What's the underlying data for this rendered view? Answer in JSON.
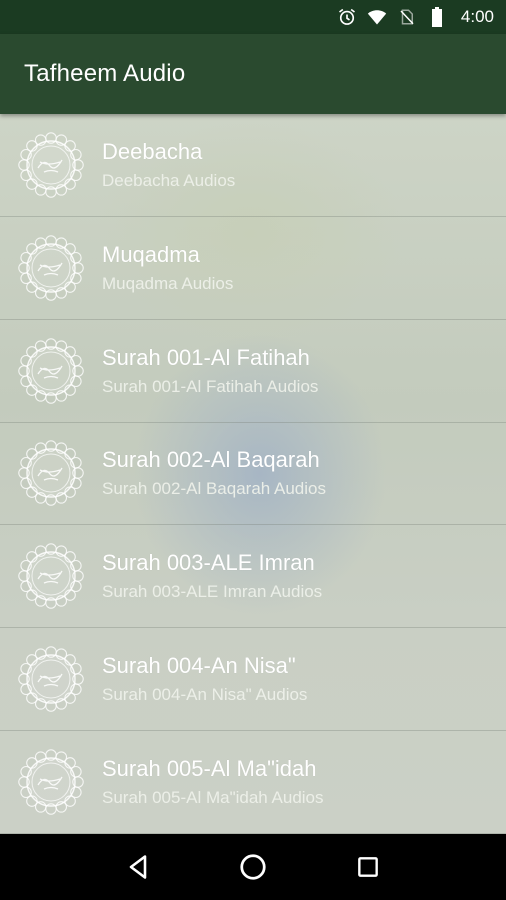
{
  "status_bar": {
    "time": "4:00",
    "icons": [
      "alarm-icon",
      "wifi-icon",
      "no-sim-icon",
      "battery-icon"
    ]
  },
  "app_bar": {
    "title": "Tafheem Audio"
  },
  "items": [
    {
      "title": "Deebacha",
      "subtitle": "Deebacha Audios"
    },
    {
      "title": "Muqadma",
      "subtitle": "Muqadma Audios"
    },
    {
      "title": "Surah 001-Al Fatihah",
      "subtitle": "Surah 001-Al Fatihah Audios"
    },
    {
      "title": "Surah 002-Al Baqarah",
      "subtitle": "Surah 002-Al Baqarah Audios"
    },
    {
      "title": "Surah 003-ALE Imran",
      "subtitle": "Surah 003-ALE Imran Audios"
    },
    {
      "title": "Surah 004-An Nisa\"",
      "subtitle": "Surah 004-An Nisa\" Audios"
    },
    {
      "title": "Surah 005-Al Ma\"idah",
      "subtitle": "Surah 005-Al Ma\"idah Audios"
    }
  ],
  "nav_bar": {
    "buttons": [
      "back-icon",
      "home-icon",
      "recents-icon"
    ]
  },
  "colors": {
    "status_bar": "#1b3b22",
    "app_bar": "#2a4a2f",
    "list_background": "#c9cfc4",
    "text": "#ffffff",
    "nav_bar": "#000000"
  }
}
